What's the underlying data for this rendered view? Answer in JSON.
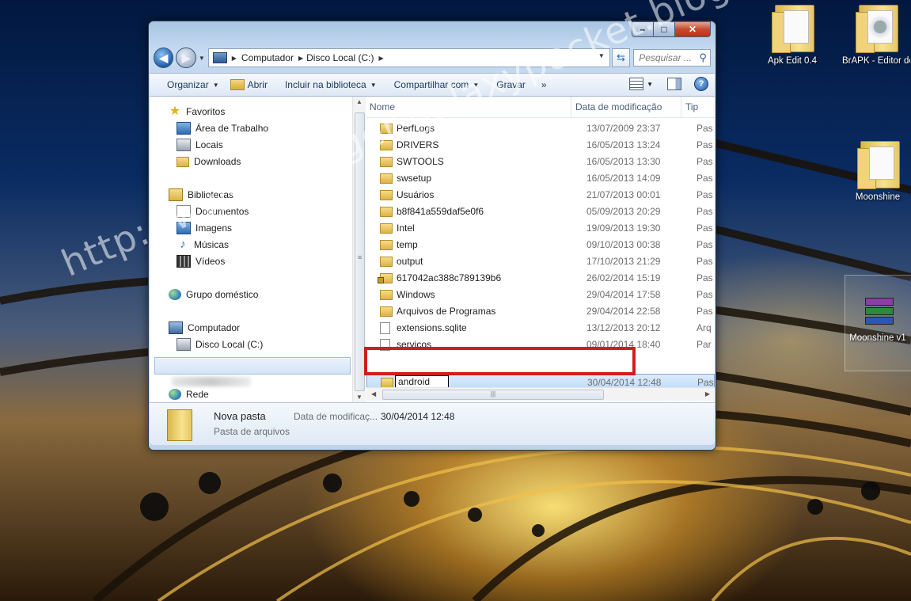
{
  "watermark": "http://www.blogger-galaxypocket.blogspot.com.br/",
  "desktop_icons": [
    {
      "label": "Apk Edit 0.4",
      "icon": "folder-icon"
    },
    {
      "label": "BrAPK - Editor de Aplicativos",
      "icon": "settings-folder-icon"
    },
    {
      "label": "Moonshine",
      "icon": "folder-icon"
    },
    {
      "label": "Moonshine v1",
      "icon": "winrar-archive-icon"
    }
  ],
  "window": {
    "controls": {
      "minimize": "–",
      "maximize": "□",
      "close": "✕"
    },
    "address": {
      "segments": [
        "Computador",
        "Disco Local (C:)"
      ]
    },
    "search": {
      "placeholder": "Pesquisar ..."
    },
    "toolbar": {
      "organize": "Organizar",
      "open": "Abrir",
      "include": "Incluir na biblioteca",
      "share": "Compartilhar com",
      "burn": "Gravar",
      "more": "»"
    },
    "nav": {
      "favorites": "Favoritos",
      "desktop": "Área de Trabalho",
      "places": "Locais",
      "downloads": "Downloads",
      "libraries": "Bibliotecas",
      "documents": "Documentos",
      "pictures": "Imagens",
      "music": "Músicas",
      "videos": "Vídeos",
      "homegroup": "Grupo doméstico",
      "computer": "Computador",
      "local_disk": "Disco Local (C:)",
      "network": "Rede"
    },
    "columns": {
      "name": "Nome",
      "date": "Data de modificação",
      "type": "Tip"
    },
    "files": [
      {
        "name": "PerfLogs",
        "date": "13/07/2009 23:37",
        "type": "Pas",
        "kind": "folder"
      },
      {
        "name": "DRIVERS",
        "date": "16/05/2013 13:24",
        "type": "Pas",
        "kind": "folder"
      },
      {
        "name": "SWTOOLS",
        "date": "16/05/2013 13:30",
        "type": "Pas",
        "kind": "folder"
      },
      {
        "name": "swsetup",
        "date": "16/05/2013 14:09",
        "type": "Pas",
        "kind": "folder"
      },
      {
        "name": "Usuários",
        "date": "21/07/2013 00:01",
        "type": "Pas",
        "kind": "folder"
      },
      {
        "name": "b8f841a559daf5e0f6",
        "date": "05/09/2013 20:29",
        "type": "Pas",
        "kind": "folder"
      },
      {
        "name": "Intel",
        "date": "19/09/2013 19:30",
        "type": "Pas",
        "kind": "folder"
      },
      {
        "name": "temp",
        "date": "09/10/2013 00:38",
        "type": "Pas",
        "kind": "folder"
      },
      {
        "name": "output",
        "date": "17/10/2013 21:29",
        "type": "Pas",
        "kind": "folder"
      },
      {
        "name": "617042ac388c789139b6",
        "date": "26/02/2014 15:19",
        "type": "Pas",
        "kind": "locked-folder"
      },
      {
        "name": "Windows",
        "date": "29/04/2014 17:58",
        "type": "Pas",
        "kind": "folder"
      },
      {
        "name": "Arquivos de Programas",
        "date": "29/04/2014 22:58",
        "type": "Pas",
        "kind": "folder"
      },
      {
        "name": "extensions.sqlite",
        "date": "13/12/2013 20:12",
        "type": "Arq",
        "kind": "file"
      },
      {
        "name": "serviços",
        "date": "09/01/2014 18:40",
        "type": "Par",
        "kind": "file"
      }
    ],
    "renaming": {
      "value": "android",
      "date": "30/04/2014 12:48",
      "type": "Pas"
    },
    "details": {
      "name": "Nova pasta",
      "kind": "Pasta de arquivos",
      "date_label": "Data de modificaç...",
      "date_value": "30/04/2014 12:48"
    }
  }
}
